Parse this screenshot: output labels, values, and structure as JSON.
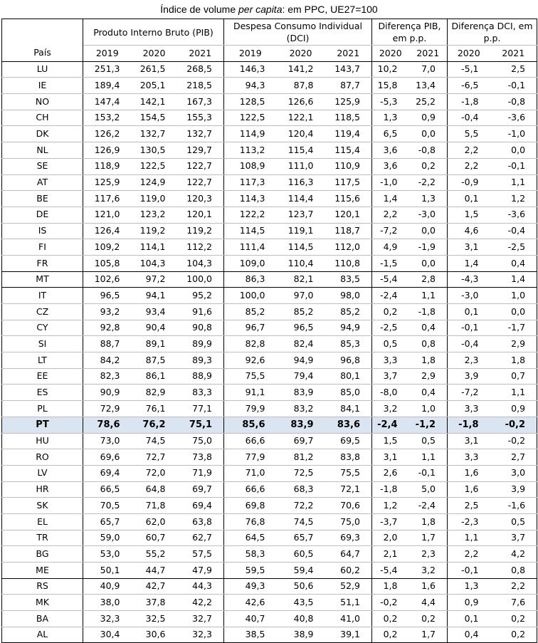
{
  "title": {
    "prefix": "Índice de volume ",
    "italic": "per capita",
    "suffix": ": em PPC, UE27=100"
  },
  "headers": {
    "pib": "Produto Interno Bruto (PIB)",
    "dci": "Despesa Consumo Individual (DCI)",
    "dif_pib": "Diferença PIB, em p.p.",
    "dif_dci": "Diferença DCI, em p.p.",
    "pais": "País",
    "years3": [
      "2019",
      "2020",
      "2021"
    ],
    "years2": [
      "2020",
      "2021"
    ]
  },
  "rows": [
    {
      "c": "LU",
      "v": [
        "251,3",
        "261,5",
        "268,5",
        "146,3",
        "141,2",
        "143,7",
        "10,2",
        "7,0",
        "-5,1",
        "2,5"
      ]
    },
    {
      "c": "IE",
      "v": [
        "189,4",
        "205,1",
        "218,5",
        "94,3",
        "87,8",
        "87,7",
        "15,8",
        "13,4",
        "-6,5",
        "-0,1"
      ]
    },
    {
      "c": "NO",
      "v": [
        "147,4",
        "142,1",
        "167,3",
        "128,5",
        "126,6",
        "125,9",
        "-5,3",
        "25,2",
        "-1,8",
        "-0,8"
      ]
    },
    {
      "c": "CH",
      "v": [
        "153,2",
        "154,5",
        "155,3",
        "122,5",
        "122,1",
        "118,5",
        "1,3",
        "0,9",
        "-0,4",
        "-3,6"
      ]
    },
    {
      "c": "DK",
      "v": [
        "126,2",
        "132,7",
        "132,7",
        "114,9",
        "120,4",
        "119,4",
        "6,5",
        "0,0",
        "5,5",
        "-1,0"
      ]
    },
    {
      "c": "NL",
      "v": [
        "126,9",
        "130,5",
        "129,7",
        "113,2",
        "115,4",
        "115,4",
        "3,6",
        "-0,8",
        "2,2",
        "0,0"
      ]
    },
    {
      "c": "SE",
      "v": [
        "118,9",
        "122,5",
        "122,7",
        "108,9",
        "111,0",
        "110,9",
        "3,6",
        "0,2",
        "2,2",
        "-0,1"
      ]
    },
    {
      "c": "AT",
      "v": [
        "125,9",
        "124,9",
        "122,7",
        "117,3",
        "116,3",
        "117,5",
        "-1,0",
        "-2,2",
        "-0,9",
        "1,1"
      ]
    },
    {
      "c": "BE",
      "v": [
        "117,6",
        "119,0",
        "120,3",
        "114,3",
        "114,4",
        "115,6",
        "1,4",
        "1,3",
        "0,1",
        "1,2"
      ]
    },
    {
      "c": "DE",
      "v": [
        "121,0",
        "123,2",
        "120,1",
        "122,2",
        "123,7",
        "120,1",
        "2,2",
        "-3,0",
        "1,5",
        "-3,6"
      ]
    },
    {
      "c": "IS",
      "v": [
        "126,4",
        "119,2",
        "119,2",
        "114,5",
        "119,1",
        "118,7",
        "-7,2",
        "0,0",
        "4,6",
        "-0,4"
      ]
    },
    {
      "c": "FI",
      "v": [
        "109,2",
        "114,1",
        "112,2",
        "111,4",
        "114,5",
        "112,0",
        "4,9",
        "-1,9",
        "3,1",
        "-2,5"
      ]
    },
    {
      "c": "FR",
      "v": [
        "105,8",
        "104,3",
        "104,3",
        "109,0",
        "110,4",
        "110,8",
        "-1,5",
        "0,0",
        "1,4",
        "0,4"
      ]
    },
    {
      "c": "MT",
      "v": [
        "102,6",
        "97,2",
        "100,0",
        "86,3",
        "82,1",
        "83,5",
        "-5,4",
        "2,8",
        "-4,3",
        "1,4"
      ]
    },
    {
      "c": "IT",
      "v": [
        "96,5",
        "94,1",
        "95,2",
        "100,0",
        "97,0",
        "98,0",
        "-2,4",
        "1,1",
        "-3,0",
        "1,0"
      ]
    },
    {
      "c": "CZ",
      "v": [
        "93,2",
        "93,4",
        "91,6",
        "85,2",
        "85,2",
        "85,2",
        "0,2",
        "-1,8",
        "0,1",
        "0,0"
      ]
    },
    {
      "c": "CY",
      "v": [
        "92,8",
        "90,4",
        "90,8",
        "96,7",
        "96,5",
        "94,9",
        "-2,5",
        "0,4",
        "-0,1",
        "-1,7"
      ]
    },
    {
      "c": "SI",
      "v": [
        "88,7",
        "89,1",
        "89,9",
        "82,8",
        "82,4",
        "85,3",
        "0,5",
        "0,8",
        "-0,4",
        "2,9"
      ]
    },
    {
      "c": "LT",
      "v": [
        "84,2",
        "87,5",
        "89,3",
        "92,6",
        "94,9",
        "96,8",
        "3,3",
        "1,8",
        "2,3",
        "1,8"
      ]
    },
    {
      "c": "EE",
      "v": [
        "82,3",
        "86,1",
        "88,9",
        "75,5",
        "79,4",
        "80,1",
        "3,7",
        "2,9",
        "3,9",
        "0,7"
      ]
    },
    {
      "c": "ES",
      "v": [
        "90,9",
        "82,9",
        "83,3",
        "91,1",
        "83,9",
        "85,0",
        "-8,0",
        "0,4",
        "-7,2",
        "1,1"
      ]
    },
    {
      "c": "PL",
      "v": [
        "72,9",
        "76,1",
        "77,1",
        "79,9",
        "83,2",
        "84,1",
        "3,2",
        "1,0",
        "3,3",
        "0,9"
      ]
    },
    {
      "c": "PT",
      "v": [
        "78,6",
        "76,2",
        "75,1",
        "85,6",
        "83,9",
        "83,6",
        "-2,4",
        "-1,2",
        "-1,8",
        "-0,2"
      ]
    },
    {
      "c": "HU",
      "v": [
        "73,0",
        "74,5",
        "75,0",
        "66,6",
        "69,7",
        "69,5",
        "1,5",
        "0,5",
        "3,1",
        "-0,2"
      ]
    },
    {
      "c": "RO",
      "v": [
        "69,6",
        "72,7",
        "73,8",
        "77,9",
        "81,2",
        "83,8",
        "3,1",
        "1,1",
        "3,3",
        "2,7"
      ]
    },
    {
      "c": "LV",
      "v": [
        "69,4",
        "72,0",
        "71,9",
        "71,0",
        "72,5",
        "75,5",
        "2,6",
        "-0,1",
        "1,6",
        "3,0"
      ]
    },
    {
      "c": "HR",
      "v": [
        "66,5",
        "64,8",
        "69,7",
        "66,6",
        "68,3",
        "72,1",
        "-1,8",
        "5,0",
        "1,6",
        "3,9"
      ]
    },
    {
      "c": "SK",
      "v": [
        "70,5",
        "71,8",
        "69,4",
        "69,8",
        "72,2",
        "70,6",
        "1,2",
        "-2,4",
        "2,5",
        "-1,6"
      ]
    },
    {
      "c": "EL",
      "v": [
        "65,7",
        "62,0",
        "63,8",
        "76,8",
        "74,5",
        "75,0",
        "-3,7",
        "1,8",
        "-2,3",
        "0,5"
      ]
    },
    {
      "c": "TR",
      "v": [
        "59,0",
        "60,7",
        "62,7",
        "64,5",
        "65,7",
        "69,3",
        "2,0",
        "1,7",
        "1,1",
        "3,7"
      ]
    },
    {
      "c": "BG",
      "v": [
        "53,0",
        "55,2",
        "57,5",
        "58,3",
        "60,5",
        "64,7",
        "2,1",
        "2,3",
        "2,2",
        "4,2"
      ]
    },
    {
      "c": "ME",
      "v": [
        "50,1",
        "44,7",
        "47,9",
        "59,5",
        "59,4",
        "60,2",
        "-5,4",
        "3,2",
        "-0,1",
        "0,8"
      ]
    },
    {
      "c": "RS",
      "v": [
        "40,9",
        "42,7",
        "44,3",
        "49,3",
        "50,6",
        "52,9",
        "1,8",
        "1,6",
        "1,3",
        "2,2"
      ]
    },
    {
      "c": "MK",
      "v": [
        "38,0",
        "37,8",
        "42,2",
        "42,6",
        "43,5",
        "51,1",
        "-0,2",
        "4,4",
        "0,9",
        "7,6"
      ]
    },
    {
      "c": "BA",
      "v": [
        "32,3",
        "32,5",
        "32,7",
        "40,7",
        "40,8",
        "41,0",
        "0,2",
        "0,2",
        "0,1",
        "0,2"
      ]
    },
    {
      "c": "AL",
      "v": [
        "30,4",
        "30,6",
        "32,3",
        "38,5",
        "38,9",
        "39,1",
        "0,2",
        "1,7",
        "0,4",
        "0,2"
      ]
    }
  ]
}
